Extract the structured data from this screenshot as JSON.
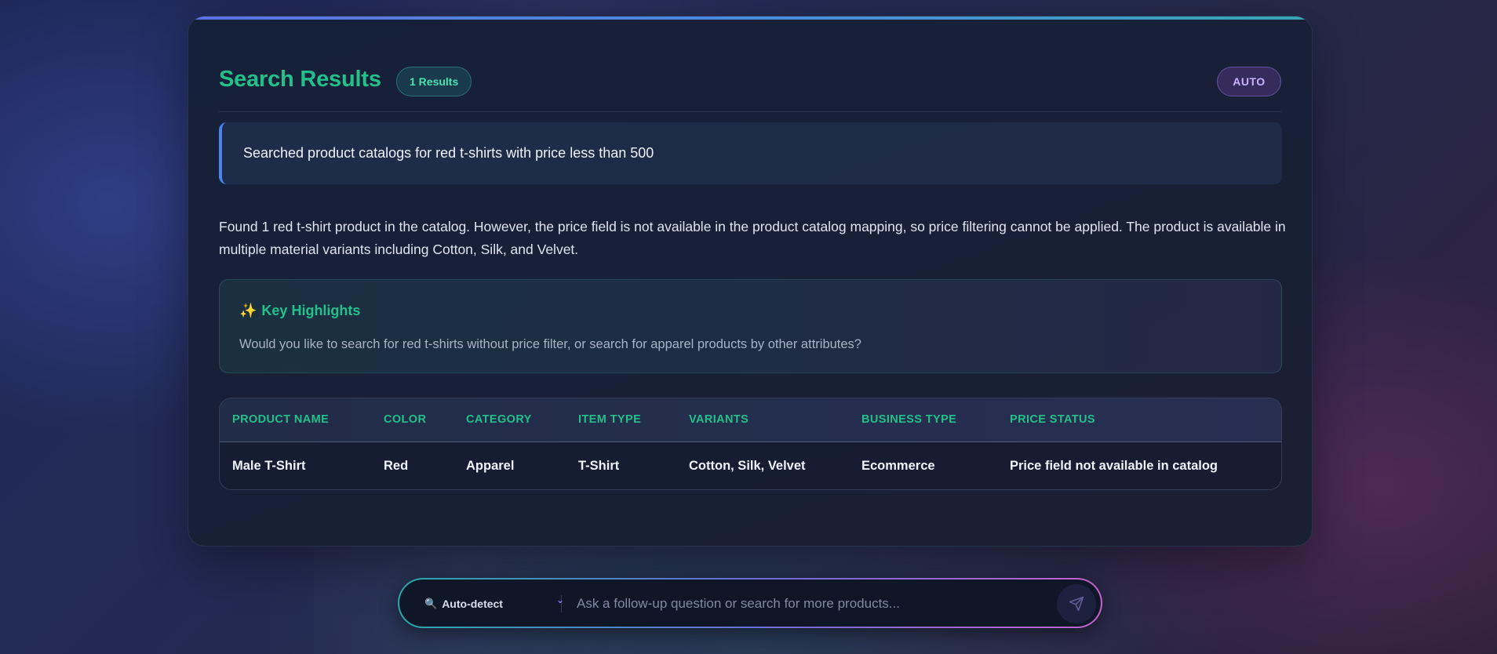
{
  "header": {
    "title": "Search Results",
    "results_badge": "1 Results",
    "mode_badge": "AUTO"
  },
  "query": {
    "text": "Searched product catalogs for red t-shirts with price less than 500"
  },
  "summary": {
    "text": "Found 1 red t-shirt product in the catalog. However, the price field is not available in the product catalog mapping, so price filtering cannot be applied. The product is available in multiple material variants including Cotton, Silk, and Velvet."
  },
  "highlights": {
    "icon": "sparkles-icon",
    "title": "Key Highlights",
    "text": "Would you like to search for red t-shirts without price filter, or search for apparel products by other attributes?"
  },
  "table": {
    "columns": [
      "PRODUCT NAME",
      "COLOR",
      "CATEGORY",
      "ITEM TYPE",
      "VARIANTS",
      "BUSINESS TYPE",
      "PRICE STATUS"
    ],
    "rows": [
      [
        "Male T-Shirt",
        "Red",
        "Apparel",
        "T-Shirt",
        "Cotton, Silk, Velvet",
        "Ecommerce",
        "Price field not available in catalog"
      ]
    ]
  },
  "input_bar": {
    "mode_label": "Auto-detect",
    "mode_icon": "search-icon",
    "placeholder": "Ask a follow-up question or search for more products...",
    "send_icon": "send-icon"
  },
  "colors": {
    "accent_green": "#24c08a",
    "accent_blue": "#4a82ee",
    "accent_purple": "#c9b2ff"
  }
}
